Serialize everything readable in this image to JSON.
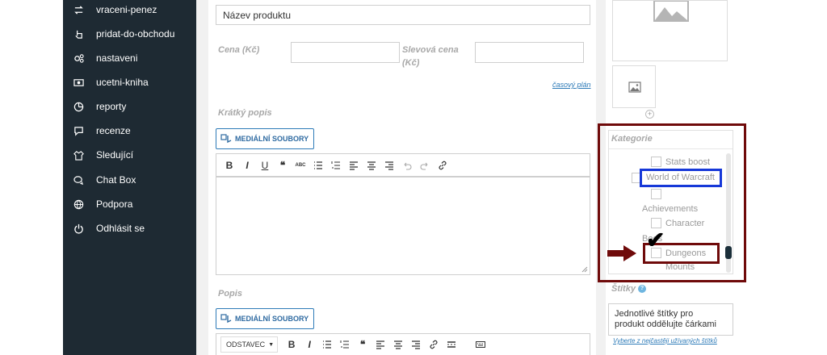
{
  "sidebar": {
    "items": [
      {
        "label": "vraceni-penez",
        "icon": "refund-arrows-icon"
      },
      {
        "label": "pridat-do-obchodu",
        "icon": "hand-pointer-icon"
      },
      {
        "label": "nastaveni",
        "icon": "gears-icon"
      },
      {
        "label": "ucetni-kniha",
        "icon": "money-bill-icon"
      },
      {
        "label": "reporty",
        "icon": "pie-chart-icon"
      },
      {
        "label": "recenze",
        "icon": "comment-icon"
      },
      {
        "label": "Sledující",
        "icon": "shirt-icon"
      },
      {
        "label": "Chat Box",
        "icon": "chat-bubbles-icon"
      },
      {
        "label": "Podpora",
        "icon": "globe-icon"
      },
      {
        "label": "Odhlásit se",
        "icon": "power-icon"
      }
    ]
  },
  "product": {
    "name_placeholder": "Název produktu",
    "price_label": "Cena (Kč)",
    "price_value": "",
    "sale_price_label_line1": "Slevová cena",
    "sale_price_label_line2": "(Kč)",
    "sale_price_value": "",
    "schedule_link": "časový plán",
    "short_desc_label": "Krátký popis",
    "desc_label": "Popis",
    "media_button": "MEDIÁLNÍ SOUBORY",
    "format_select": "ODSTAVEC"
  },
  "categories": {
    "title": "Kategorie",
    "items": [
      {
        "label": "Stats boost",
        "checked": false
      },
      {
        "label": "World of Warcraft",
        "checked": false
      },
      {
        "label": "Achievements",
        "checked": false
      },
      {
        "label": "Character",
        "checked": false
      },
      {
        "label": "Boos",
        "checked": false
      },
      {
        "label": "Dungeons",
        "checked": true
      },
      {
        "label": "Mounts",
        "checked": false
      }
    ],
    "checkmark": "✔"
  },
  "tags": {
    "title": "Štítky",
    "badge": "?",
    "input_line1": "Jednotlivé štítky pro",
    "input_line2": "produkt oddělujte čárkami",
    "choose_link": "Vyberte z nejčastěji užívaných štítků"
  },
  "annotations": {
    "arrow_color": "#6f0a0a",
    "frame_color": "#6f0a0a",
    "highlight_color": "#1638d8"
  }
}
